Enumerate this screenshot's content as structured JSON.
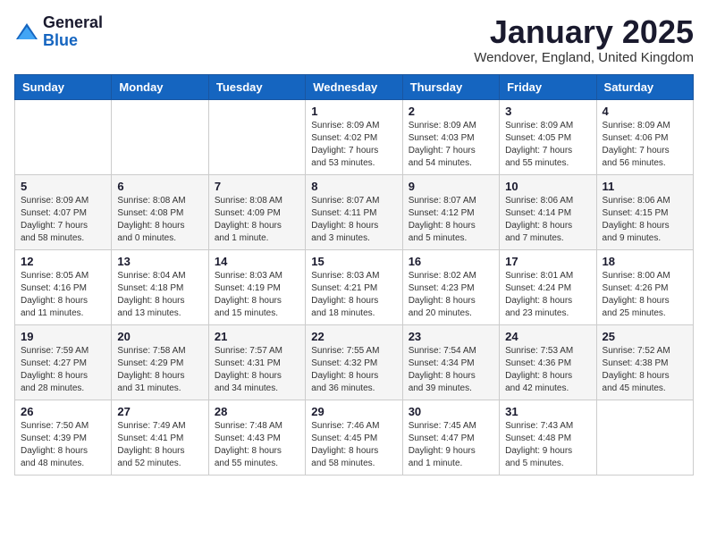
{
  "logo": {
    "general": "General",
    "blue": "Blue"
  },
  "title": "January 2025",
  "location": "Wendover, England, United Kingdom",
  "days_header": [
    "Sunday",
    "Monday",
    "Tuesday",
    "Wednesday",
    "Thursday",
    "Friday",
    "Saturday"
  ],
  "weeks": [
    [
      {
        "day": "",
        "info": ""
      },
      {
        "day": "",
        "info": ""
      },
      {
        "day": "",
        "info": ""
      },
      {
        "day": "1",
        "info": "Sunrise: 8:09 AM\nSunset: 4:02 PM\nDaylight: 7 hours\nand 53 minutes."
      },
      {
        "day": "2",
        "info": "Sunrise: 8:09 AM\nSunset: 4:03 PM\nDaylight: 7 hours\nand 54 minutes."
      },
      {
        "day": "3",
        "info": "Sunrise: 8:09 AM\nSunset: 4:05 PM\nDaylight: 7 hours\nand 55 minutes."
      },
      {
        "day": "4",
        "info": "Sunrise: 8:09 AM\nSunset: 4:06 PM\nDaylight: 7 hours\nand 56 minutes."
      }
    ],
    [
      {
        "day": "5",
        "info": "Sunrise: 8:09 AM\nSunset: 4:07 PM\nDaylight: 7 hours\nand 58 minutes."
      },
      {
        "day": "6",
        "info": "Sunrise: 8:08 AM\nSunset: 4:08 PM\nDaylight: 8 hours\nand 0 minutes."
      },
      {
        "day": "7",
        "info": "Sunrise: 8:08 AM\nSunset: 4:09 PM\nDaylight: 8 hours\nand 1 minute."
      },
      {
        "day": "8",
        "info": "Sunrise: 8:07 AM\nSunset: 4:11 PM\nDaylight: 8 hours\nand 3 minutes."
      },
      {
        "day": "9",
        "info": "Sunrise: 8:07 AM\nSunset: 4:12 PM\nDaylight: 8 hours\nand 5 minutes."
      },
      {
        "day": "10",
        "info": "Sunrise: 8:06 AM\nSunset: 4:14 PM\nDaylight: 8 hours\nand 7 minutes."
      },
      {
        "day": "11",
        "info": "Sunrise: 8:06 AM\nSunset: 4:15 PM\nDaylight: 8 hours\nand 9 minutes."
      }
    ],
    [
      {
        "day": "12",
        "info": "Sunrise: 8:05 AM\nSunset: 4:16 PM\nDaylight: 8 hours\nand 11 minutes."
      },
      {
        "day": "13",
        "info": "Sunrise: 8:04 AM\nSunset: 4:18 PM\nDaylight: 8 hours\nand 13 minutes."
      },
      {
        "day": "14",
        "info": "Sunrise: 8:03 AM\nSunset: 4:19 PM\nDaylight: 8 hours\nand 15 minutes."
      },
      {
        "day": "15",
        "info": "Sunrise: 8:03 AM\nSunset: 4:21 PM\nDaylight: 8 hours\nand 18 minutes."
      },
      {
        "day": "16",
        "info": "Sunrise: 8:02 AM\nSunset: 4:23 PM\nDaylight: 8 hours\nand 20 minutes."
      },
      {
        "day": "17",
        "info": "Sunrise: 8:01 AM\nSunset: 4:24 PM\nDaylight: 8 hours\nand 23 minutes."
      },
      {
        "day": "18",
        "info": "Sunrise: 8:00 AM\nSunset: 4:26 PM\nDaylight: 8 hours\nand 25 minutes."
      }
    ],
    [
      {
        "day": "19",
        "info": "Sunrise: 7:59 AM\nSunset: 4:27 PM\nDaylight: 8 hours\nand 28 minutes."
      },
      {
        "day": "20",
        "info": "Sunrise: 7:58 AM\nSunset: 4:29 PM\nDaylight: 8 hours\nand 31 minutes."
      },
      {
        "day": "21",
        "info": "Sunrise: 7:57 AM\nSunset: 4:31 PM\nDaylight: 8 hours\nand 34 minutes."
      },
      {
        "day": "22",
        "info": "Sunrise: 7:55 AM\nSunset: 4:32 PM\nDaylight: 8 hours\nand 36 minutes."
      },
      {
        "day": "23",
        "info": "Sunrise: 7:54 AM\nSunset: 4:34 PM\nDaylight: 8 hours\nand 39 minutes."
      },
      {
        "day": "24",
        "info": "Sunrise: 7:53 AM\nSunset: 4:36 PM\nDaylight: 8 hours\nand 42 minutes."
      },
      {
        "day": "25",
        "info": "Sunrise: 7:52 AM\nSunset: 4:38 PM\nDaylight: 8 hours\nand 45 minutes."
      }
    ],
    [
      {
        "day": "26",
        "info": "Sunrise: 7:50 AM\nSunset: 4:39 PM\nDaylight: 8 hours\nand 48 minutes."
      },
      {
        "day": "27",
        "info": "Sunrise: 7:49 AM\nSunset: 4:41 PM\nDaylight: 8 hours\nand 52 minutes."
      },
      {
        "day": "28",
        "info": "Sunrise: 7:48 AM\nSunset: 4:43 PM\nDaylight: 8 hours\nand 55 minutes."
      },
      {
        "day": "29",
        "info": "Sunrise: 7:46 AM\nSunset: 4:45 PM\nDaylight: 8 hours\nand 58 minutes."
      },
      {
        "day": "30",
        "info": "Sunrise: 7:45 AM\nSunset: 4:47 PM\nDaylight: 9 hours\nand 1 minute."
      },
      {
        "day": "31",
        "info": "Sunrise: 7:43 AM\nSunset: 4:48 PM\nDaylight: 9 hours\nand 5 minutes."
      },
      {
        "day": "",
        "info": ""
      }
    ]
  ]
}
